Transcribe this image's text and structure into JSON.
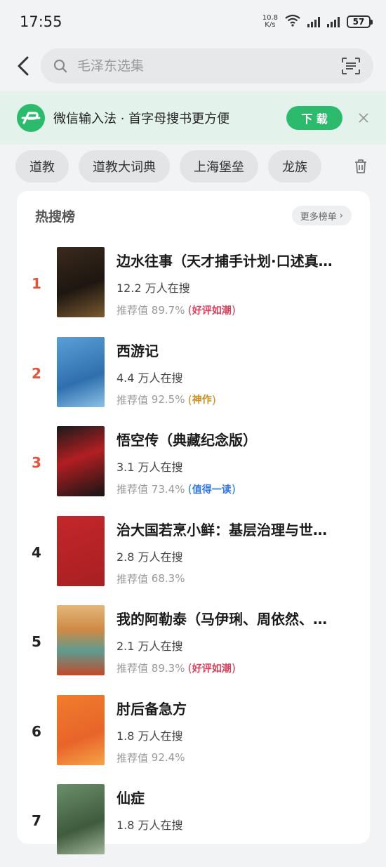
{
  "status": {
    "time": "17:55",
    "net_speed_top": "10.8",
    "net_speed_bottom": "K/s",
    "battery": "57"
  },
  "search": {
    "placeholder": "毛泽东选集"
  },
  "banner": {
    "text": "微信输入法 · 首字母搜书更方便",
    "download_label": "下 载"
  },
  "history": [
    "道教",
    "道教大词典",
    "上海堡垒",
    "龙族"
  ],
  "hot": {
    "title": "热搜榜",
    "more_label": "更多榜单",
    "items": [
      {
        "rank": "1",
        "title": "边水往事（天才捕手计划·口述真…",
        "count": "12.2 万人在搜",
        "score_label": "推荐值",
        "score": "89.7%",
        "badge": "好评如潮",
        "badge_color": "#d7405c"
      },
      {
        "rank": "2",
        "title": "西游记",
        "count": "4.4 万人在搜",
        "score_label": "推荐值",
        "score": "92.5%",
        "badge": "神作",
        "badge_color": "#c99021"
      },
      {
        "rank": "3",
        "title": "悟空传（典藏纪念版）",
        "count": "3.1 万人在搜",
        "score_label": "推荐值",
        "score": "73.4%",
        "badge": "值得一读",
        "badge_color": "#2f78e0"
      },
      {
        "rank": "4",
        "title": "治大国若烹小鲜：基层治理与世…",
        "count": "2.8 万人在搜",
        "score_label": "推荐值",
        "score": "68.3%",
        "badge": ""
      },
      {
        "rank": "5",
        "title": "我的阿勒泰（马伊琍、周依然、…",
        "count": "2.1 万人在搜",
        "score_label": "推荐值",
        "score": "89.3%",
        "badge": "好评如潮",
        "badge_color": "#d7405c"
      },
      {
        "rank": "6",
        "title": "肘后备急方",
        "count": "1.8 万人在搜",
        "score_label": "推荐值",
        "score": "92.4%",
        "badge": ""
      },
      {
        "rank": "7",
        "title": "仙症",
        "count": "1.8 万人在搜",
        "score_label": "",
        "score": "",
        "badge": ""
      }
    ]
  }
}
